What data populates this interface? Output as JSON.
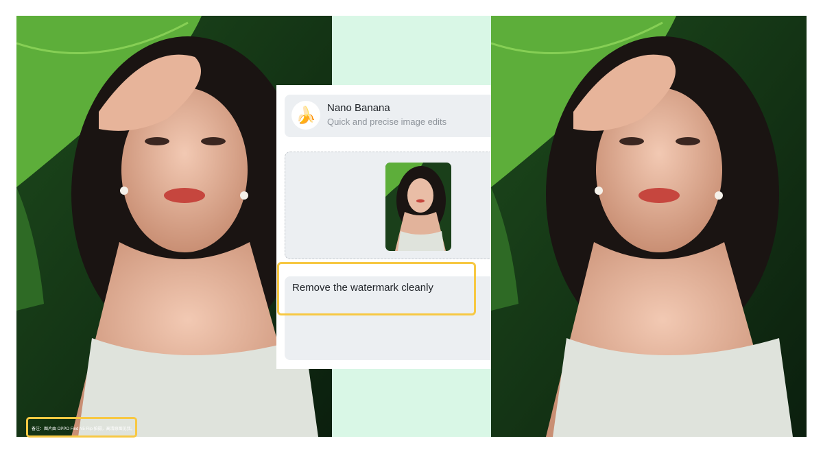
{
  "images": {
    "original_alt": "Portrait of woman under a banana leaf with watermark",
    "edited_alt": "Same portrait with watermark removed",
    "watermark_text": "备注：图片由 OPPO Find N5 Flip 拍摄，高清原图见我。"
  },
  "tool_card": {
    "logo_icon": "banana-icon",
    "logo_glyph": "🍌",
    "title": "Nano Banana",
    "subtitle": "Quick and precise image edits"
  },
  "prompt": {
    "text": "Remove the watermark cleanly"
  },
  "colors": {
    "highlight": "#f7c843",
    "mint_background": "#d9f7e6",
    "card_background": "#eceff2"
  }
}
